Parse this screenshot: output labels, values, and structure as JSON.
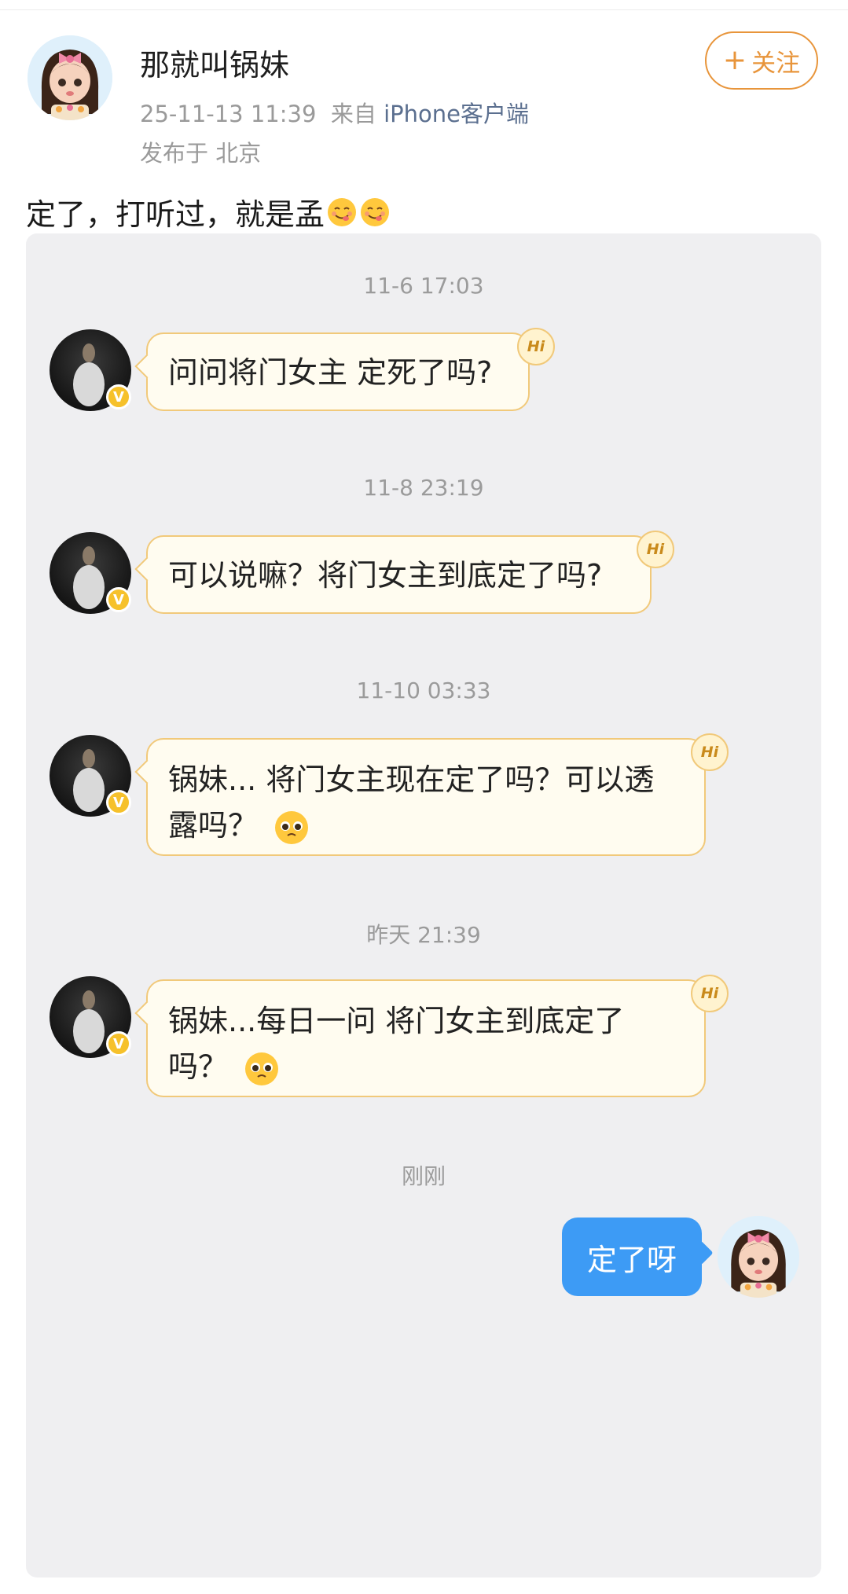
{
  "post": {
    "username": "那就叫锅妹",
    "timestamp": "25-11-13 11:39",
    "source_prefix": "来自",
    "source_device": "iPhone客户端",
    "location": "发布于 北京",
    "follow_label": "关注",
    "text": "定了，打听过，就是孟"
  },
  "chat": {
    "messages": [
      {
        "time": "11-6 17:03",
        "text": "问问将门女主 定死了吗?"
      },
      {
        "time": "11-8 23:19",
        "text": "可以说嘛？将门女主到底定了吗?"
      },
      {
        "time": "11-10 03:33",
        "line1": "锅妹... 将门女主现在定了吗？可以透",
        "line2": "露吗？"
      },
      {
        "time": "昨天 21:39",
        "line1": "锅妹...每日一问 将门女主到底定了",
        "line2": "吗？"
      }
    ],
    "reply_time": "刚刚",
    "reply_text": "定了呀",
    "hi_label": "Hi"
  },
  "icons": {
    "verified": "verified-v-badge-icon",
    "hi": "hi-sticker-icon",
    "pleading_face": "pleading-face-emoji",
    "yum_face": "savoring-face-emoji"
  },
  "colors": {
    "accent_orange": "#e8953b",
    "bubble_border": "#f1c97a",
    "sent_bubble": "#3d9bf5",
    "panel_bg": "#efeff1"
  }
}
